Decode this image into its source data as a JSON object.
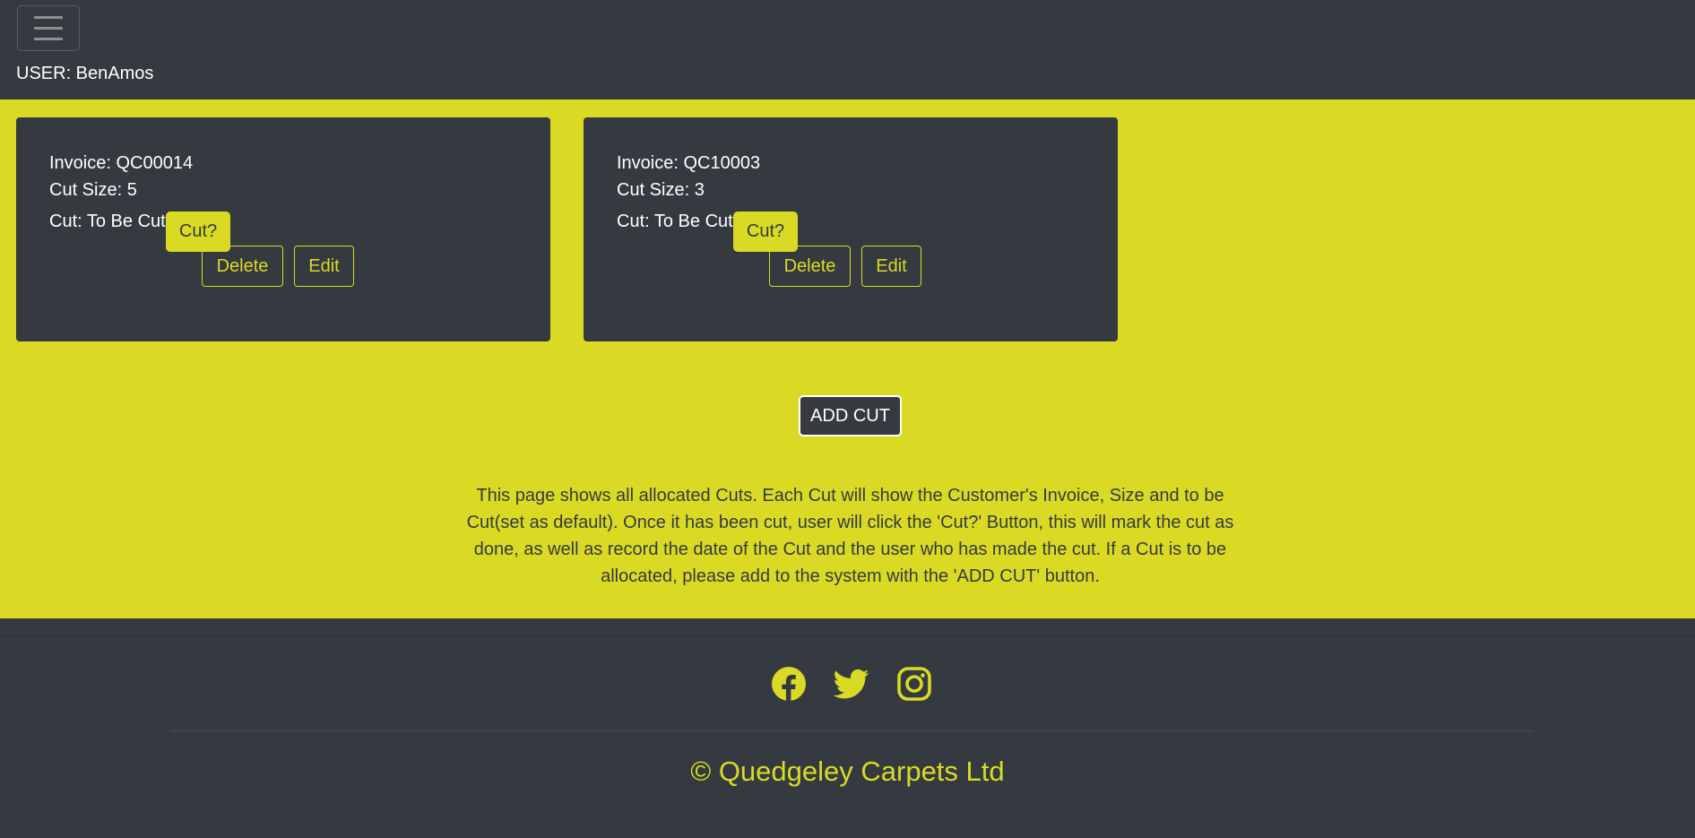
{
  "header": {
    "user_label": "USER: BenAmos"
  },
  "cards": [
    {
      "invoice": "Invoice: QC00014",
      "cut_size": "Cut Size: 5",
      "cut_status": "Cut: To Be Cut",
      "cut_button": "Cut?",
      "delete_button": "Delete",
      "edit_button": "Edit"
    },
    {
      "invoice": "Invoice: QC10003",
      "cut_size": "Cut Size: 3",
      "cut_status": "Cut: To Be Cut",
      "cut_button": "Cut?",
      "delete_button": "Delete",
      "edit_button": "Edit"
    }
  ],
  "add_cut_button": "ADD CUT",
  "info_text": "This page shows all allocated Cuts. Each Cut will show the Customer's Invoice, Size and to be Cut(set as default). Once it has been cut, user will click the 'Cut?' Button, this will mark the cut as done, as well as record the date of the Cut and the user who has made the cut. If a Cut is to be allocated, please add to the system with the 'ADD CUT' button.",
  "footer": {
    "social_icons": [
      "facebook-icon",
      "twitter-icon",
      "instagram-icon"
    ],
    "copyright": "© Quedgeley Carpets Ltd"
  },
  "colors": {
    "accent": "#dada24",
    "dark": "#343a40"
  }
}
